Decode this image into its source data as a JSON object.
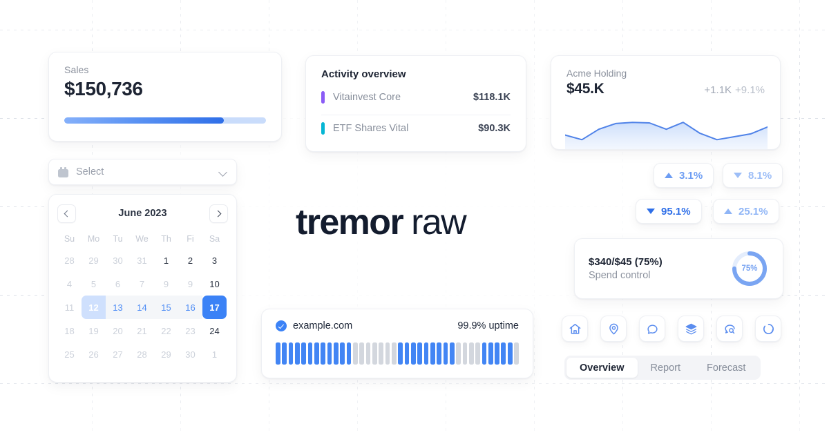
{
  "logo": {
    "bold": "tremor",
    "light": "raw"
  },
  "sales_card": {
    "label": "Sales",
    "value": "$150,736",
    "progress_percent": 79,
    "track_color": "#c9dcfb",
    "fill_color_start": "#85b0fa",
    "fill_color_end": "#2f6fe8"
  },
  "activity_card": {
    "title": "Activity overview",
    "rows": [
      {
        "name": "Vitainvest Core",
        "amount": "$118.1K",
        "color": "#8b5cf6"
      },
      {
        "name": "ETF Shares Vital",
        "amount": "$90.3K",
        "color": "#06b6d4"
      }
    ]
  },
  "acme_card": {
    "label": "Acme Holding",
    "value": "$45.K",
    "delta_absolute": "+1.1K",
    "delta_percent": "+9.1%",
    "line_color": "#4f82e8",
    "chart_data": {
      "type": "area",
      "title": "Acme Holding",
      "x": [
        0,
        1,
        2,
        3,
        4,
        5,
        6,
        7,
        8,
        9,
        10,
        11,
        12
      ],
      "values": [
        52,
        44,
        62,
        72,
        74,
        73,
        62,
        74,
        55,
        44,
        49,
        54,
        66
      ],
      "ylim": [
        30,
        85
      ],
      "xlabel": "",
      "ylabel": "",
      "grid": false,
      "legend": "none"
    }
  },
  "select": {
    "placeholder": "Select",
    "icon": "calendar-icon",
    "chevron": "chevron-down-icon"
  },
  "calendar": {
    "month_label": "June 2023",
    "prev_label": "‹",
    "next_label": "›",
    "weekdays": [
      "Su",
      "Mo",
      "Tu",
      "We",
      "Th",
      "Fi",
      "Sa"
    ],
    "weeks": [
      [
        {
          "d": "28",
          "state": "muted"
        },
        {
          "d": "29",
          "state": "muted"
        },
        {
          "d": "30",
          "state": "muted"
        },
        {
          "d": "31",
          "state": "muted"
        },
        {
          "d": "1",
          "state": "normal"
        },
        {
          "d": "2",
          "state": "normal"
        },
        {
          "d": "3",
          "state": "normal"
        }
      ],
      [
        {
          "d": "4",
          "state": "muted"
        },
        {
          "d": "5",
          "state": "muted"
        },
        {
          "d": "6",
          "state": "muted"
        },
        {
          "d": "7",
          "state": "muted"
        },
        {
          "d": "9",
          "state": "muted"
        },
        {
          "d": "9",
          "state": "muted"
        },
        {
          "d": "10",
          "state": "normal"
        }
      ],
      [
        {
          "d": "11",
          "state": "muted"
        },
        {
          "d": "12",
          "state": "range-start"
        },
        {
          "d": "13",
          "state": "range"
        },
        {
          "d": "14",
          "state": "range"
        },
        {
          "d": "15",
          "state": "range"
        },
        {
          "d": "16",
          "state": "range"
        },
        {
          "d": "17",
          "state": "range-end"
        }
      ],
      [
        {
          "d": "18",
          "state": "muted"
        },
        {
          "d": "19",
          "state": "muted"
        },
        {
          "d": "20",
          "state": "muted"
        },
        {
          "d": "21",
          "state": "muted"
        },
        {
          "d": "22",
          "state": "muted"
        },
        {
          "d": "23",
          "state": "muted"
        },
        {
          "d": "24",
          "state": "normal"
        }
      ],
      [
        {
          "d": "25",
          "state": "muted"
        },
        {
          "d": "26",
          "state": "muted"
        },
        {
          "d": "27",
          "state": "muted"
        },
        {
          "d": "28",
          "state": "muted"
        },
        {
          "d": "29",
          "state": "muted"
        },
        {
          "d": "30",
          "state": "muted"
        },
        {
          "d": "1",
          "state": "muted"
        }
      ]
    ]
  },
  "uptime_card": {
    "domain": "example.com",
    "uptime": "99.9% uptime",
    "status_icon": "check-circle-icon",
    "up_color": "#4285f4",
    "down_color": "#d3d7de",
    "bars": [
      "up",
      "up",
      "up",
      "up",
      "up",
      "up",
      "up",
      "up",
      "up",
      "up",
      "up",
      "up",
      "down",
      "down",
      "down",
      "down",
      "down",
      "down",
      "down",
      "up",
      "up",
      "up",
      "up",
      "up",
      "up",
      "up",
      "up",
      "up",
      "down",
      "down",
      "down",
      "down",
      "up",
      "up",
      "up",
      "up",
      "up",
      "down"
    ]
  },
  "badges": [
    {
      "id": "badge-1",
      "direction": "up",
      "value": "3.1%",
      "color": "#6d9df3"
    },
    {
      "id": "badge-2",
      "direction": "down",
      "value": "8.1%",
      "color": "#9dbef7"
    },
    {
      "id": "badge-3",
      "direction": "down",
      "value": "95.1%",
      "color": "#2f6fe8"
    },
    {
      "id": "badge-4",
      "direction": "up",
      "value": "25.1%",
      "color": "#8fb5f6"
    }
  ],
  "spend_card": {
    "title": "$340/$45 (75%)",
    "subtitle": "Spend control",
    "donut_label": "75%",
    "donut_percent": 75,
    "donut_color": "#7aa5f2",
    "donut_track": "#e4edfc"
  },
  "icon_buttons": [
    {
      "name": "home-icon"
    },
    {
      "name": "map-pin-icon"
    },
    {
      "name": "chat-bubble-icon"
    },
    {
      "name": "layers-icon"
    },
    {
      "name": "chat-search-icon"
    },
    {
      "name": "refresh-circle-icon"
    }
  ],
  "tabs": [
    {
      "label": "Overview",
      "active": true
    },
    {
      "label": "Report",
      "active": false
    },
    {
      "label": "Forecast",
      "active": false
    }
  ]
}
